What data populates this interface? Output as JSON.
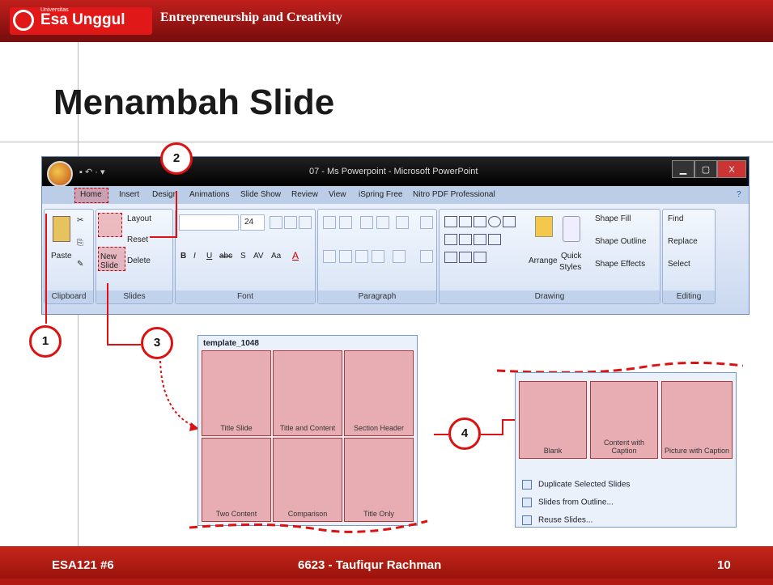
{
  "header": {
    "logo_small": "Universitas",
    "logo_text": "Esa Unggul",
    "course": "Entrepreneurship and Creativity"
  },
  "slide_title": "Menambah Slide",
  "window": {
    "title": "07 - Ms Powerpoint - Microsoft PowerPoint",
    "qat": "▪ ↶ · ▾",
    "buttons": [
      "▁",
      "▢",
      "X"
    ]
  },
  "tabs": [
    "Home",
    "Insert",
    "Design",
    "Animations",
    "Slide Show",
    "Review",
    "View",
    "iSpring Free",
    "Nitro PDF Professional"
  ],
  "groups": {
    "clipboard": {
      "label": "Clipboard",
      "paste": "Paste"
    },
    "slides": {
      "label": "Slides",
      "new_slide": "New Slide",
      "layout": "Layout",
      "reset": "Reset",
      "delete": "Delete"
    },
    "font": {
      "label": "Font",
      "size": "24"
    },
    "paragraph": {
      "label": "Paragraph"
    },
    "drawing": {
      "label": "Drawing",
      "arrange": "Arrange",
      "quick": "Quick",
      "styles": "Styles",
      "shape_fill": "Shape Fill",
      "shape_outline": "Shape Outline",
      "shape_effects": "Shape Effects"
    },
    "editing": {
      "label": "Editing",
      "find": "Find",
      "replace": "Replace",
      "select": "Select"
    }
  },
  "callouts": [
    "1",
    "2",
    "3",
    "4"
  ],
  "template_panel": {
    "title": "template_1048",
    "layouts": [
      "Title Slide",
      "Title and Content",
      "Section Header",
      "Two Content",
      "Comparison",
      "Title Only"
    ]
  },
  "dropdown_panel": {
    "layouts": [
      "Blank",
      "Content with Caption",
      "Picture with Caption"
    ],
    "menu": [
      "Duplicate Selected Slides",
      "Slides from Outline...",
      "Reuse Slides..."
    ]
  },
  "footer": {
    "left": "ESA121 #6",
    "center": "6623 - Taufiqur Rachman",
    "page": "10"
  }
}
